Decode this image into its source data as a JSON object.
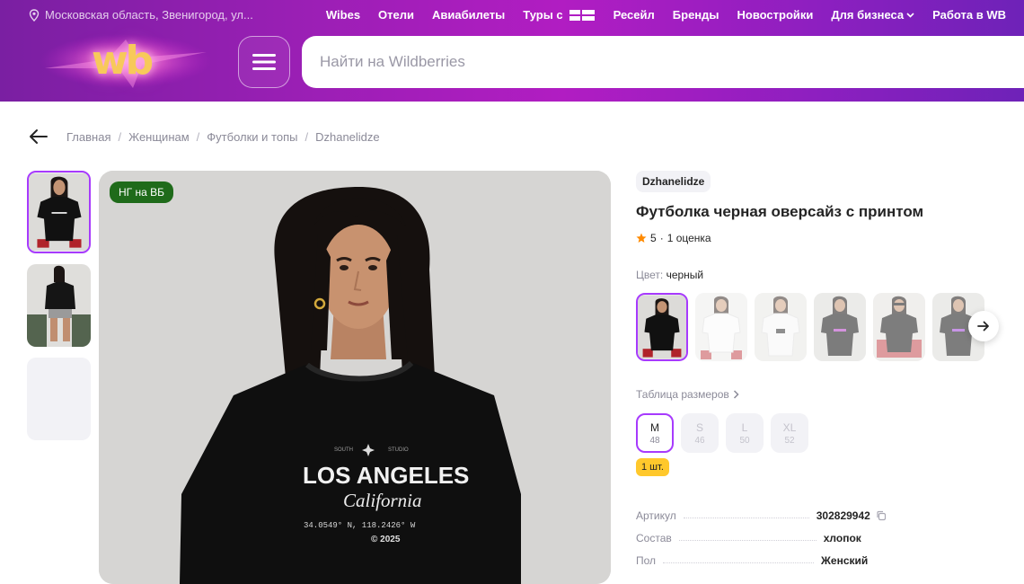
{
  "header": {
    "location": "Московская область, Звенигород, ул...",
    "nav": [
      {
        "label": "Wibes"
      },
      {
        "label": "Отели"
      },
      {
        "label": "Авиабилеты"
      },
      {
        "label": "Туры с"
      },
      {
        "label": "Ресейл"
      },
      {
        "label": "Бренды"
      },
      {
        "label": "Новостройки"
      },
      {
        "label": "Для бизнеса"
      },
      {
        "label": "Работа в WB"
      }
    ],
    "logo": "wb",
    "search_placeholder": "Найти на Wildberries"
  },
  "breadcrumb": [
    "Главная",
    "Женщинам",
    "Футболки и топы",
    "Dzhanelidze"
  ],
  "gallery": {
    "promo_badge": "НГ на ВБ",
    "print": {
      "line1": "LOS ANGELES",
      "line2": "California",
      "coords": "34.0549° N, 118.2426° W",
      "year": "© 2025"
    }
  },
  "product": {
    "brand": "Dzhanelidze",
    "title": "Футболка черная оверсайз с принтом",
    "rating": "5",
    "reviews": "1 оценка",
    "color_label": "Цвет:",
    "color_value": "черный",
    "sizes_table_label": "Таблица размеров",
    "sizes": [
      {
        "letter": "M",
        "number": "48",
        "selected": true
      },
      {
        "letter": "S",
        "number": "46",
        "selected": false
      },
      {
        "letter": "L",
        "number": "50",
        "selected": false
      },
      {
        "letter": "XL",
        "number": "52",
        "selected": false
      }
    ],
    "stock": "1 шт.",
    "specs": [
      {
        "key": "Артикул",
        "value": "302829942"
      },
      {
        "key": "Состав",
        "value": "хлопок"
      },
      {
        "key": "Пол",
        "value": "Женский"
      }
    ]
  },
  "colors": {
    "accent": "#a73afd",
    "header_purple": "#9b1fb5",
    "promo_green": "#1f6b1a",
    "stock_yellow": "#ffc82c",
    "star_orange": "#ff8a00"
  }
}
